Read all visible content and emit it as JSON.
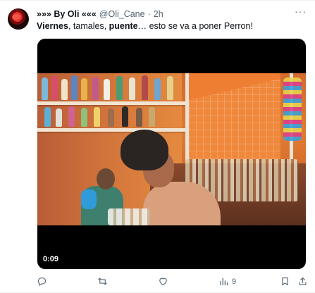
{
  "tweet": {
    "display_name": "»»» By Oli «««",
    "handle": "@Oli_Cane",
    "separator": "·",
    "time": "2h",
    "more_label": "···",
    "text_bold_1": "Viernes",
    "text_sep_1": ", ",
    "text_plain_1": "tamales",
    "text_sep_2": ", ",
    "text_bold_2": "puente",
    "text_rest": "… esto se va a poner Perron!"
  },
  "video": {
    "timestamp": "0:09"
  },
  "actions": {
    "views_count": "9"
  },
  "icons": {
    "reply": "reply-icon",
    "retweet": "retweet-icon",
    "like": "heart-icon",
    "views": "views-icon",
    "bookmark": "bookmark-icon",
    "share": "share-icon",
    "more": "more-icon"
  },
  "colors": {
    "text_primary": "#0f1419",
    "text_secondary": "#536471",
    "video_bg": "#000000"
  }
}
